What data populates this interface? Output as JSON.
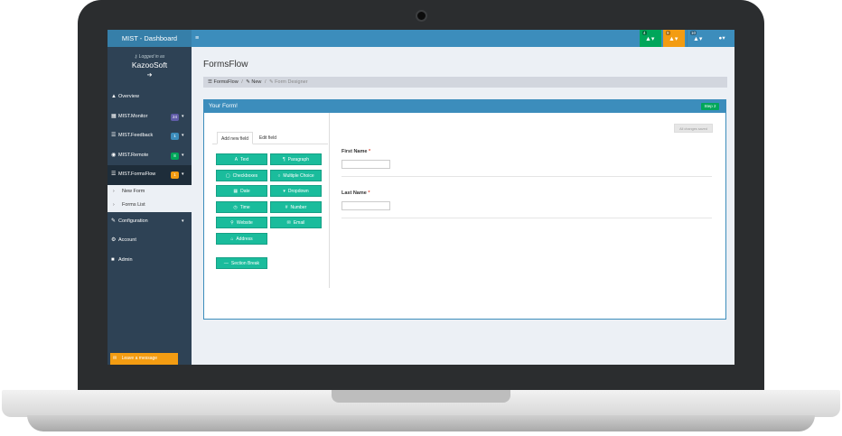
{
  "brand": "MIST - Dashboard",
  "topbar": {
    "menu_icon": "≡",
    "notifications": [
      {
        "count": "4",
        "icon": "bell-icon",
        "color": "#00a65a"
      },
      {
        "count": "9",
        "icon": "bell-icon",
        "color": "#f39c12"
      },
      {
        "count": "10",
        "icon": "bell-icon",
        "color": "#3c8dbc"
      }
    ],
    "user_icon": "user-icon"
  },
  "sidebar": {
    "logged_in_as": "Logged in as",
    "company": "KazooSoft",
    "items": [
      {
        "label": "Overview",
        "icon": "dashboard-icon"
      },
      {
        "label": "MIST.Monitor",
        "badge": "24",
        "badge_color": "#605ca8"
      },
      {
        "label": "MIST.Feedback",
        "badge": "1",
        "badge_color": "#3c8dbc"
      },
      {
        "label": "MIST.Remote",
        "badge": "8",
        "badge_color": "#00a65a"
      },
      {
        "label": "MIST.FormsFlow",
        "badge": "1",
        "badge_color": "#f39c12"
      },
      {
        "label": "Configuration"
      },
      {
        "label": "Account"
      },
      {
        "label": "Admin"
      }
    ],
    "submenu": [
      "New Form",
      "Forms List"
    ],
    "leave_message": "Leave a message"
  },
  "main": {
    "page_title": "FormsFlow",
    "breadcrumb": [
      "FormsFlow",
      "New",
      "Form Designer"
    ],
    "box_title": "Your Form!",
    "step_badge": "Step 2",
    "tabs": [
      "Add new field",
      "Edit field"
    ],
    "field_buttons": [
      {
        "label": "Text",
        "icon": "A"
      },
      {
        "label": "Paragraph",
        "icon": "¶"
      },
      {
        "label": "Checkboxes",
        "icon": "▢"
      },
      {
        "label": "Multiple Choice",
        "icon": "○"
      },
      {
        "label": "Date",
        "icon": "▦"
      },
      {
        "label": "Dropdown",
        "icon": "▾"
      },
      {
        "label": "Time",
        "icon": "◷"
      },
      {
        "label": "Number",
        "icon": "#"
      },
      {
        "label": "Website",
        "icon": "⚲"
      },
      {
        "label": "Email",
        "icon": "✉"
      },
      {
        "label": "Address",
        "icon": "⌂"
      }
    ],
    "section_break": "Section Break",
    "saved_label": "All changes saved",
    "fields": [
      {
        "label": "First Name",
        "required": "*"
      },
      {
        "label": "Last Name",
        "required": "*"
      }
    ]
  }
}
